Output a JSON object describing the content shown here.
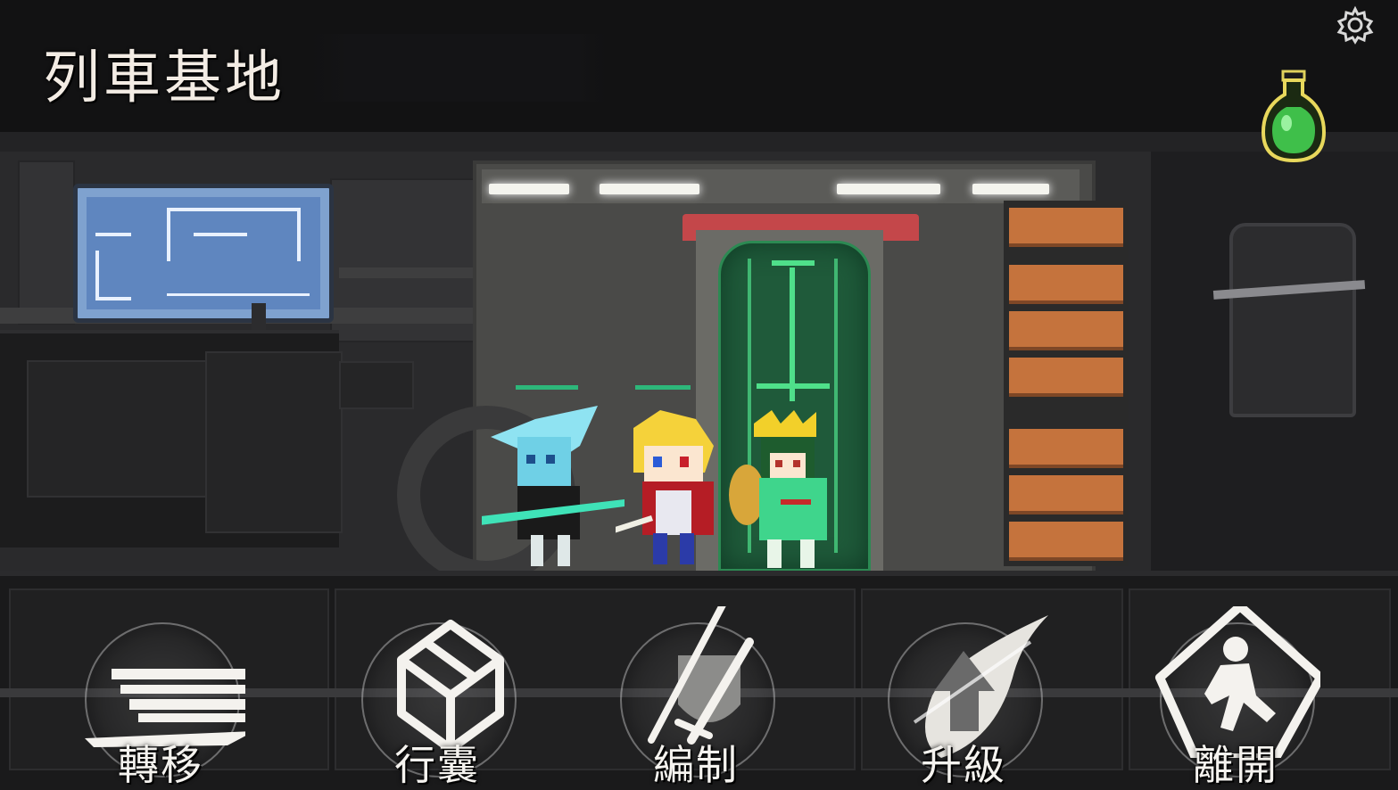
{
  "header": {
    "location_title": "列車基地"
  },
  "top_right": {
    "settings_icon": "gear-icon",
    "potion_icon": "green-potion-icon",
    "potion_color": "#3fbf4a"
  },
  "actions": [
    {
      "label": "轉移",
      "icon": "train-icon"
    },
    {
      "label": "行囊",
      "icon": "box-icon"
    },
    {
      "label": "編制",
      "icon": "weapons-shield-icon"
    },
    {
      "label": "升級",
      "icon": "upgrade-arrow-icon"
    },
    {
      "label": "離開",
      "icon": "exit-runner-icon"
    }
  ],
  "colors": {
    "door_glow": "#4fe08a",
    "door_red": "#c4474a",
    "ladder_orange": "#c5733d",
    "monitor_blue": "#7fa2cf",
    "ui_text": "#f5f3ef"
  }
}
